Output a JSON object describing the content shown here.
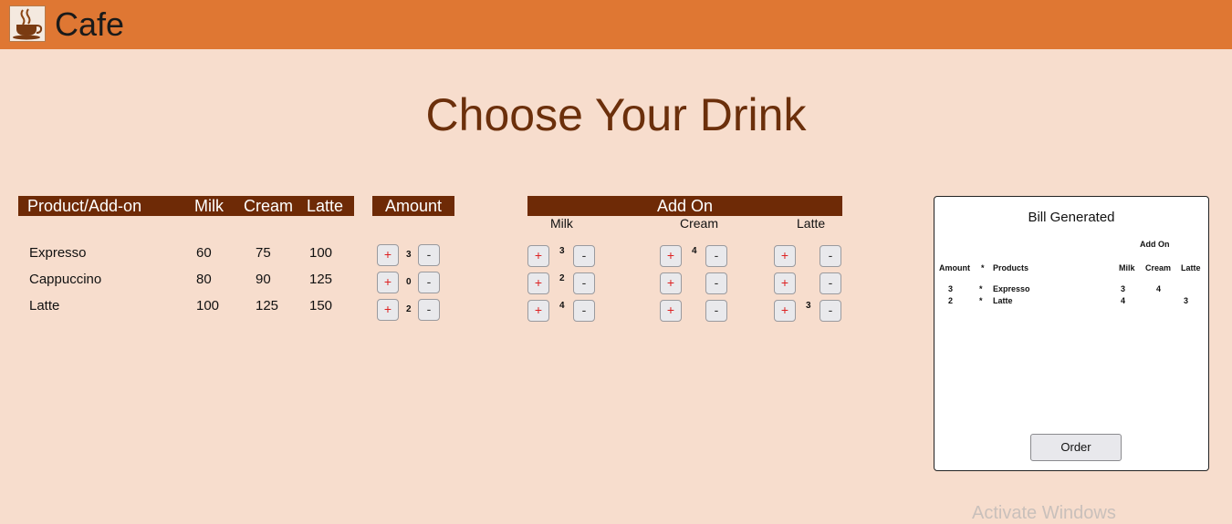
{
  "header": {
    "app_title": "Cafe",
    "logo_icon": "coffee-cup-icon"
  },
  "page_title": "Choose Your Drink",
  "menu_table": {
    "headers": [
      "Product/Add-on",
      "Milk",
      "Cream",
      "Latte"
    ],
    "rows": [
      {
        "product": "Expresso",
        "milk": "60",
        "cream": "75",
        "latte": "100"
      },
      {
        "product": "Cappuccino",
        "milk": "80",
        "cream": "90",
        "latte": "125"
      },
      {
        "product": "Latte",
        "milk": "100",
        "cream": "125",
        "latte": "150"
      }
    ]
  },
  "amount": {
    "header": "Amount",
    "plus_label": "+",
    "minus_label": "-",
    "values": [
      "3",
      "0",
      "2"
    ]
  },
  "addon": {
    "header": "Add On",
    "columns": [
      "Milk",
      "Cream",
      "Latte"
    ],
    "plus_label": "+",
    "minus_label": "-",
    "milk_values": [
      "3",
      "2",
      "4"
    ],
    "cream_values": [
      "4",
      "",
      ""
    ],
    "latte_values": [
      "",
      "",
      "3"
    ]
  },
  "bill": {
    "title": "Bill Generated",
    "addon_header": "Add On",
    "columns": {
      "amount": "Amount",
      "times": "*",
      "products": "Products",
      "milk": "Milk",
      "cream": "Cream",
      "latte": "Latte"
    },
    "rows": [
      {
        "amount": "3",
        "times": "*",
        "product": "Expresso",
        "milk": "3",
        "cream": "4",
        "latte": ""
      },
      {
        "amount": "2",
        "times": "*",
        "product": "Latte",
        "milk": "4",
        "cream": "",
        "latte": "3"
      }
    ],
    "order_label": "Order"
  },
  "watermark": "Activate Windows"
}
